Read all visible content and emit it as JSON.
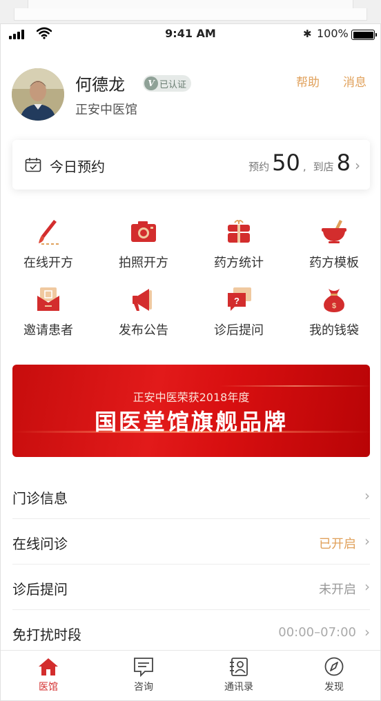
{
  "status_bar": {
    "time": "9:41 AM",
    "battery": "100%"
  },
  "profile": {
    "name": "何德龙",
    "verified_label": "已认证",
    "verified_badge": "V",
    "clinic": "正安中医馆",
    "help_label": "帮助",
    "message_label": "消息"
  },
  "appointment": {
    "label": "今日预约",
    "booked_label": "预约",
    "booked_count": "50",
    "separator": ",",
    "arrived_label": "到店",
    "arrived_count": "8"
  },
  "functions": [
    {
      "label": "在线开方",
      "icon": "brush-icon"
    },
    {
      "label": "拍照开方",
      "icon": "camera-icon"
    },
    {
      "label": "药方统计",
      "icon": "medicine-package-icon"
    },
    {
      "label": "药方模板",
      "icon": "mortar-pestle-icon"
    },
    {
      "label": "邀请患者",
      "icon": "invite-envelope-icon"
    },
    {
      "label": "发布公告",
      "icon": "megaphone-icon"
    },
    {
      "label": "诊后提问",
      "icon": "question-chat-icon"
    },
    {
      "label": "我的钱袋",
      "icon": "money-bag-icon"
    }
  ],
  "banner": {
    "subtitle": "正安中医荣获2018年度",
    "title": "国医堂馆旗舰品牌"
  },
  "settings": [
    {
      "label": "门诊信息",
      "value": "",
      "value_color": "#999999"
    },
    {
      "label": "在线问诊",
      "value": "已开启",
      "value_color": "#e0a05a"
    },
    {
      "label": "诊后提问",
      "value": "未开启",
      "value_color": "#999999"
    },
    {
      "label": "免打扰时段",
      "value": "00:00–07:00",
      "value_color": "#aaaaaa"
    }
  ],
  "tabs": [
    {
      "label": "医馆",
      "icon": "home-icon",
      "active": true
    },
    {
      "label": "咨询",
      "icon": "chat-icon",
      "active": false
    },
    {
      "label": "通讯录",
      "icon": "contacts-icon",
      "active": false
    },
    {
      "label": "发现",
      "icon": "compass-icon",
      "active": false
    }
  ],
  "colors": {
    "accent": "#d32d2d",
    "highlight": "#e0a05a"
  }
}
